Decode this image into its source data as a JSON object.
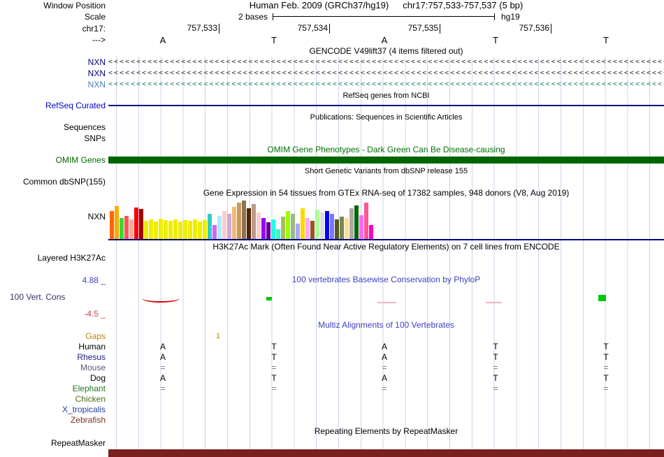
{
  "header": {
    "window_position_label": "Window Position",
    "assembly_title": "Human Feb. 2009 (GRCh37/hg19)",
    "range_title": "chr17:757,533-757,537 (5 bp)",
    "scale_label": "Scale",
    "scale_value": "2 bases",
    "assembly": "hg19",
    "chrom_label": "chr17:",
    "positions": [
      "757,533",
      "757,534",
      "757,535",
      "757,536"
    ],
    "strand_label": "--->",
    "bases": [
      "A",
      "T",
      "A",
      "T",
      "T"
    ],
    "chevron_char": "<"
  },
  "tracks": {
    "gencode": {
      "title": "GENCODE V49lift37 (4 items filtered out)",
      "items": [
        {
          "label": "NXN",
          "label_color": "#000080",
          "line_color": "#333333"
        },
        {
          "label": "NXN",
          "label_color": "#000080",
          "line_color": "#333333"
        },
        {
          "label": "NXN",
          "label_color": "#4c7fb5",
          "line_color": "#1f7a68"
        }
      ]
    },
    "refseq": {
      "title": "RefSeq genes from NCBI",
      "label": "RefSeq Curated",
      "label_color": "#0000cc",
      "line_color": "#000080"
    },
    "publications": {
      "title": "Publications: Sequences in Scientific Articles",
      "rows": [
        "Sequences",
        "SNPs"
      ]
    },
    "omim": {
      "title": "OMIM Gene Phenotypes - Dark Green Can Be Disease-causing",
      "title_color": "#007000",
      "label": "OMIM Genes",
      "label_color": "#006400",
      "bar_color": "#006400"
    },
    "dbsnp": {
      "title": "Short Genetic Variants from dbSNP release 155",
      "label": "Common dbSNP(155)"
    },
    "gtex": {
      "title": "Gene Expression in 54 tissues from GTEx RNA-seq of 17382 samples, 948 donors (V8, Aug 2019)",
      "label": "NXN",
      "baseline_color": "#000080"
    },
    "h3k27ac": {
      "title": "H3K27Ac Mark (Often Found Near Active Regulatory Elements) on 7 cell lines from ENCODE",
      "label": "Layered H3K27Ac"
    },
    "phylop": {
      "title": "100 vertebrates Basewise Conservation by PhyloP",
      "title_color": "#4040c0",
      "label": "100 Vert. Cons",
      "label_color": "#333366",
      "max_label": "4.88 _",
      "max_color": "#4040c0",
      "min_label": "-4.5 _",
      "min_color": "#cc4444"
    },
    "multiz": {
      "title": "Multiz Alignments of 100 Vertebrates",
      "title_color": "#4040c0",
      "gaps": {
        "label": "Gaps",
        "color": "#b8860b",
        "value": "1"
      },
      "species": [
        {
          "name": "Human",
          "color": "#000000",
          "cells": [
            "A",
            "T",
            "A",
            "T",
            "T"
          ],
          "cell_color": "#000000"
        },
        {
          "name": "Rhesus",
          "color": "#1a1a80",
          "cells": [
            "A",
            "T",
            "A",
            "T",
            "T"
          ],
          "cell_color": "#000000"
        },
        {
          "name": "Mouse",
          "color": "#555577",
          "cells": [
            "=",
            "=",
            "=",
            "=",
            "="
          ],
          "cell_color": "#777777"
        },
        {
          "name": "Dog",
          "color": "#000000",
          "cells": [
            "A",
            "T",
            "A",
            "T",
            "T"
          ],
          "cell_color": "#000000"
        },
        {
          "name": "Elephant",
          "color": "#1a7a1a",
          "cells": [
            "=",
            "=",
            "=",
            "=",
            "="
          ],
          "cell_color": "#777777"
        },
        {
          "name": "Chicken",
          "color": "#4a6e1a",
          "cells": [
            "",
            "",
            "",
            "",
            ""
          ],
          "cell_color": "#000000"
        },
        {
          "name": "X_tropicalis",
          "color": "#2040a0",
          "cells": [
            "",
            "",
            "",
            "",
            ""
          ],
          "cell_color": "#000000"
        },
        {
          "name": "Zebrafish",
          "color": "#803020",
          "cells": [
            "",
            "",
            "",
            "",
            ""
          ],
          "cell_color": "#000000"
        }
      ]
    },
    "repeatmasker": {
      "title": "Repeating Elements by RepeatMasker",
      "label": "RepeatMasker",
      "bar_color": "#7a1f1f"
    }
  },
  "chart_data": {
    "type": "bar",
    "title": "Gene Expression in 54 tissues from GTEx RNA-seq of 17382 samples, 948 donors (V8, Aug 2019)",
    "gene": "NXN",
    "note": "relative bar heights in px; no numeric axis is shown in the image",
    "values": [
      40,
      47,
      30,
      33,
      28,
      45,
      43,
      26,
      28,
      25,
      29,
      27,
      26,
      28,
      25,
      27,
      26,
      28,
      25,
      27,
      36,
      20,
      33,
      40,
      36,
      46,
      52,
      55,
      44,
      50,
      38,
      30,
      24,
      28,
      14,
      32,
      40,
      36,
      22,
      44,
      30,
      26,
      42,
      38,
      40,
      36,
      28,
      32,
      30,
      44,
      48,
      34,
      52,
      20
    ],
    "colors": [
      "#FF6600",
      "#FFAA00",
      "#33DD33",
      "#FF5555",
      "#FFAA99",
      "#FF0000",
      "#AA0000",
      "#EEEE00",
      "#EEEE00",
      "#EEEE00",
      "#EEEE00",
      "#EEEE00",
      "#EEEE00",
      "#EEEE00",
      "#EEEE00",
      "#EEEE00",
      "#EEEE00",
      "#EEEE00",
      "#EEEE00",
      "#EEEE00",
      "#33CCCC",
      "#CC66FF",
      "#AAEEFF",
      "#FFCCCC",
      "#CCAADD",
      "#EEBB77",
      "#CC9955",
      "#8B7355",
      "#552200",
      "#BB9988",
      "#FFCCCC",
      "#9900FF",
      "#660099",
      "#22FFDD",
      "#33FFC2",
      "#AABB66",
      "#99FF00",
      "#99BB88",
      "#AAAAFF",
      "#FFD700",
      "#FFAAFF",
      "#995522",
      "#AAFF99",
      "#DDDDDD",
      "#0000FF",
      "#7777FF",
      "#555522",
      "#778855",
      "#FFDD99",
      "#AAAAAA",
      "#006600",
      "#FF66FF",
      "#FF5599",
      "#FF00BB"
    ]
  },
  "colors": {
    "grid": "#c9d7ec",
    "phylop_positive": "#00c800",
    "phylop_negative": "#d40000",
    "phylop_faint": "#f0b4c8"
  }
}
